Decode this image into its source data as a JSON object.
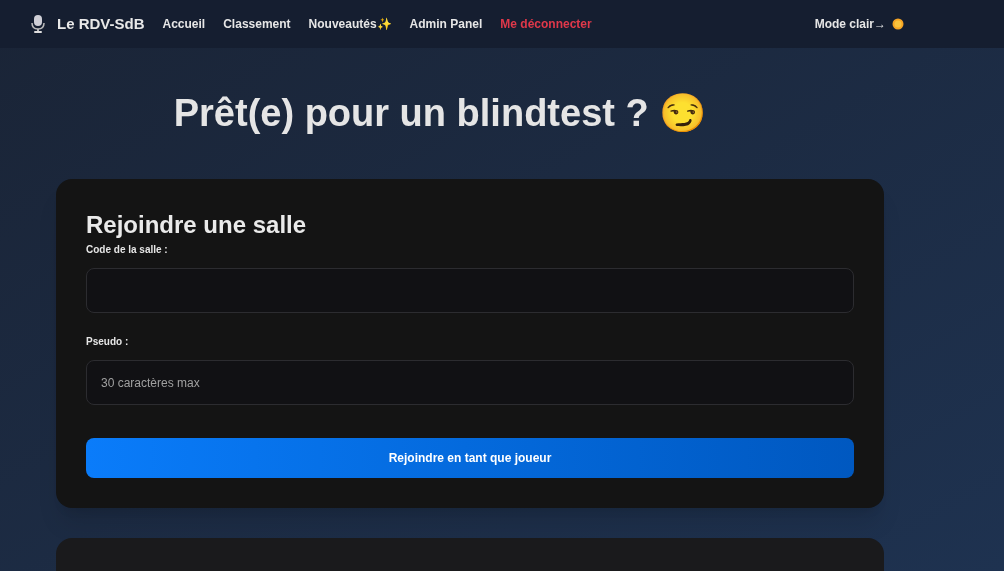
{
  "navbar": {
    "brand": "Le RDV-SdB",
    "links": [
      {
        "label": "Accueil",
        "kind": "normal"
      },
      {
        "label": "Classement",
        "kind": "normal"
      },
      {
        "label": "Nouveautés✨",
        "kind": "normal"
      },
      {
        "label": "Admin Panel",
        "kind": "normal"
      },
      {
        "label": "Me déconnecter",
        "kind": "danger"
      }
    ],
    "theme_toggle": "Mode clair→"
  },
  "heading": "Prêt(e) pour un blindtest ? 😏",
  "join_card": {
    "title": "Rejoindre une salle",
    "fields": [
      {
        "label": "Code de la salle :"
      },
      {
        "label": "Pseudo :",
        "placeholder": "30 caractères max"
      }
    ],
    "button": "Rejoindre en tant que joueur"
  }
}
